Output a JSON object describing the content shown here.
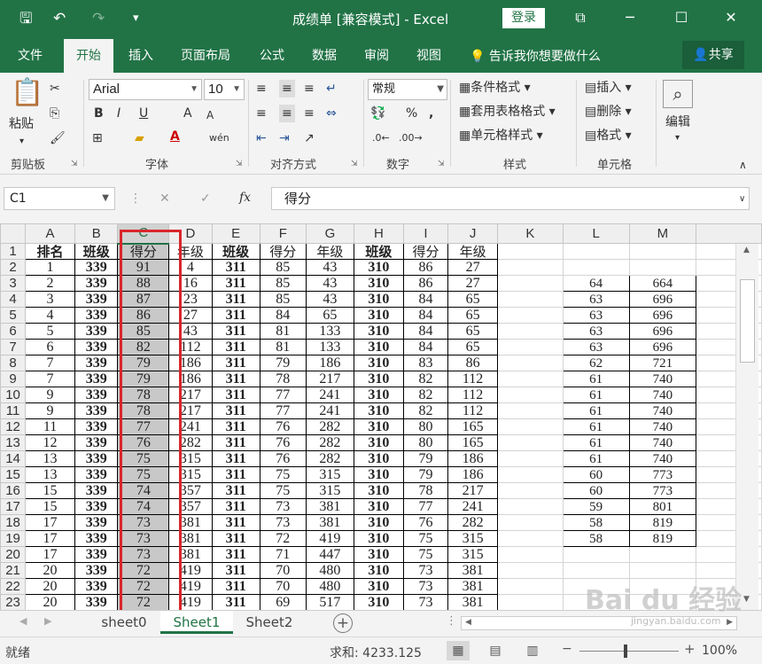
{
  "window": {
    "title": "成绩单 [兼容模式] - Excel",
    "login": "登录",
    "minimize": "─",
    "maximize": "☐",
    "close": "✕",
    "restore_icon": "⧉",
    "quick_access": {
      "save": "🖫",
      "undo": "↶",
      "redo": "↷",
      "customize": "▾"
    }
  },
  "tabs": {
    "file": "文件",
    "home": "开始",
    "insert": "插入",
    "page_layout": "页面布局",
    "formulas": "公式",
    "data": "数据",
    "review": "审阅",
    "view": "视图",
    "tell_me": "告诉我你想要做什么",
    "share": "共享"
  },
  "ribbon": {
    "clipboard": {
      "label": "剪贴板",
      "paste": "粘贴"
    },
    "font": {
      "label": "字体",
      "name": "Arial",
      "size": "10",
      "bold": "B",
      "italic": "I",
      "underline": "U",
      "grow": "A",
      "shrink": "A",
      "color": "A",
      "wen": "wén"
    },
    "alignment": {
      "label": "对齐方式"
    },
    "number": {
      "label": "数字",
      "format": "常规",
      "percent": "%",
      "comma": ","
    },
    "styles": {
      "label": "样式",
      "conditional": "条件格式",
      "table": "套用表格格式",
      "cell": "单元格样式"
    },
    "cells": {
      "label": "单元格",
      "insert": "插入",
      "delete": "删除",
      "format": "格式"
    },
    "editing": {
      "label": "编辑"
    }
  },
  "formula_bar": {
    "name_box": "C1",
    "fx": "fx",
    "cancel": "✕",
    "enter": "✓",
    "content": "得分"
  },
  "sheet": {
    "columns": [
      "A",
      "B",
      "C",
      "D",
      "E",
      "F",
      "G",
      "H",
      "I",
      "J",
      "K",
      "L",
      "M"
    ],
    "selected_column": "C",
    "header_row": [
      "排名",
      "班级",
      "得分",
      "年级",
      "班级",
      "得分",
      "年级",
      "班级",
      "得分",
      "年级"
    ],
    "rows": [
      {
        "n": "2",
        "cells": [
          "1",
          "339",
          "91",
          "4",
          "311",
          "85",
          "43",
          "310",
          "86",
          "27"
        ],
        "lm": [
          "",
          ""
        ]
      },
      {
        "n": "3",
        "cells": [
          "2",
          "339",
          "88",
          "16",
          "311",
          "85",
          "43",
          "310",
          "86",
          "27"
        ],
        "lm": [
          "64",
          "664"
        ]
      },
      {
        "n": "4",
        "cells": [
          "3",
          "339",
          "87",
          "23",
          "311",
          "85",
          "43",
          "310",
          "84",
          "65"
        ],
        "lm": [
          "63",
          "696"
        ]
      },
      {
        "n": "5",
        "cells": [
          "4",
          "339",
          "86",
          "27",
          "311",
          "84",
          "65",
          "310",
          "84",
          "65"
        ],
        "lm": [
          "63",
          "696"
        ]
      },
      {
        "n": "6",
        "cells": [
          "5",
          "339",
          "85",
          "43",
          "311",
          "81",
          "133",
          "310",
          "84",
          "65"
        ],
        "lm": [
          "63",
          "696"
        ]
      },
      {
        "n": "7",
        "cells": [
          "6",
          "339",
          "82",
          "112",
          "311",
          "81",
          "133",
          "310",
          "84",
          "65"
        ],
        "lm": [
          "63",
          "696"
        ]
      },
      {
        "n": "8",
        "cells": [
          "7",
          "339",
          "79",
          "186",
          "311",
          "79",
          "186",
          "310",
          "83",
          "86"
        ],
        "lm": [
          "62",
          "721"
        ]
      },
      {
        "n": "9",
        "cells": [
          "7",
          "339",
          "79",
          "186",
          "311",
          "78",
          "217",
          "310",
          "82",
          "112"
        ],
        "lm": [
          "61",
          "740"
        ]
      },
      {
        "n": "10",
        "cells": [
          "9",
          "339",
          "78",
          "217",
          "311",
          "77",
          "241",
          "310",
          "82",
          "112"
        ],
        "lm": [
          "61",
          "740"
        ]
      },
      {
        "n": "11",
        "cells": [
          "9",
          "339",
          "78",
          "217",
          "311",
          "77",
          "241",
          "310",
          "82",
          "112"
        ],
        "lm": [
          "61",
          "740"
        ]
      },
      {
        "n": "12",
        "cells": [
          "11",
          "339",
          "77",
          "241",
          "311",
          "76",
          "282",
          "310",
          "80",
          "165"
        ],
        "lm": [
          "61",
          "740"
        ]
      },
      {
        "n": "13",
        "cells": [
          "12",
          "339",
          "76",
          "282",
          "311",
          "76",
          "282",
          "310",
          "80",
          "165"
        ],
        "lm": [
          "61",
          "740"
        ]
      },
      {
        "n": "14",
        "cells": [
          "13",
          "339",
          "75",
          "315",
          "311",
          "76",
          "282",
          "310",
          "79",
          "186"
        ],
        "lm": [
          "61",
          "740"
        ]
      },
      {
        "n": "15",
        "cells": [
          "13",
          "339",
          "75",
          "315",
          "311",
          "75",
          "315",
          "310",
          "79",
          "186"
        ],
        "lm": [
          "60",
          "773"
        ]
      },
      {
        "n": "16",
        "cells": [
          "15",
          "339",
          "74",
          "357",
          "311",
          "75",
          "315",
          "310",
          "78",
          "217"
        ],
        "lm": [
          "60",
          "773"
        ]
      },
      {
        "n": "17",
        "cells": [
          "15",
          "339",
          "74",
          "357",
          "311",
          "73",
          "381",
          "310",
          "77",
          "241"
        ],
        "lm": [
          "59",
          "801"
        ]
      },
      {
        "n": "18",
        "cells": [
          "17",
          "339",
          "73",
          "381",
          "311",
          "73",
          "381",
          "310",
          "76",
          "282"
        ],
        "lm": [
          "58",
          "819"
        ]
      },
      {
        "n": "19",
        "cells": [
          "17",
          "339",
          "73",
          "381",
          "311",
          "72",
          "419",
          "310",
          "75",
          "315"
        ],
        "lm": [
          "58",
          "819"
        ]
      },
      {
        "n": "20",
        "cells": [
          "17",
          "339",
          "73",
          "381",
          "311",
          "71",
          "447",
          "310",
          "75",
          "315"
        ],
        "lm": [
          "",
          ""
        ]
      },
      {
        "n": "21",
        "cells": [
          "20",
          "339",
          "72",
          "419",
          "311",
          "70",
          "480",
          "310",
          "73",
          "381"
        ],
        "lm": [
          "",
          ""
        ]
      },
      {
        "n": "22",
        "cells": [
          "20",
          "339",
          "72",
          "419",
          "311",
          "70",
          "480",
          "310",
          "73",
          "381"
        ],
        "lm": [
          "",
          ""
        ]
      },
      {
        "n": "23",
        "cells": [
          "20",
          "339",
          "72",
          "419",
          "311",
          "69",
          "517",
          "310",
          "73",
          "381"
        ],
        "lm": [
          "",
          ""
        ]
      }
    ]
  },
  "sheet_tabs": {
    "sheet0": "sheet0",
    "sheet1": "Sheet1",
    "sheet2": "Sheet2",
    "add": "+"
  },
  "status": {
    "ready": "就绪",
    "sum": "求和: 4233.125",
    "zoom": "100%"
  },
  "watermark": {
    "main": "Bai du 经验",
    "sub": "jingyan.baidu.com"
  },
  "colors": {
    "excel_green": "#217346",
    "highlight_red": "#d9262b",
    "selected_fill": "#c8c8c8"
  }
}
